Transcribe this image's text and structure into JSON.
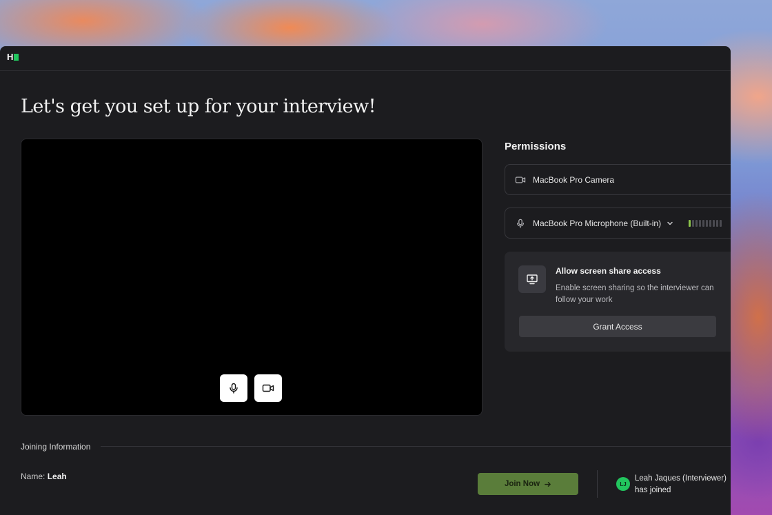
{
  "app": {
    "logo_letter": "H",
    "accent": "#22c55e"
  },
  "page": {
    "title": "Let's get you set up for your interview!"
  },
  "video": {
    "mic_button_icon": "microphone-icon",
    "camera_button_icon": "video-camera-icon"
  },
  "permissions": {
    "title": "Permissions",
    "camera": {
      "label": "MacBook Pro Camera",
      "icon": "video-camera-icon"
    },
    "microphone": {
      "label": "MacBook Pro Microphone (Built-in)",
      "icon": "microphone-icon",
      "level_fraction": 0.1
    },
    "screen_share": {
      "title": "Allow screen share access",
      "description": "Enable screen sharing so the interviewer can follow your work",
      "button_label": "Grant Access",
      "icon": "screen-share-icon"
    }
  },
  "joining": {
    "section_label": "Joining Information",
    "name_label": "Name:",
    "name_value": "Leah",
    "join_button_label": "Join Now",
    "join_button_color": "#5a7d3a",
    "participant": {
      "initials": "LJ",
      "name": "Leah Jaques (Interviewer)",
      "status": "has joined"
    }
  }
}
